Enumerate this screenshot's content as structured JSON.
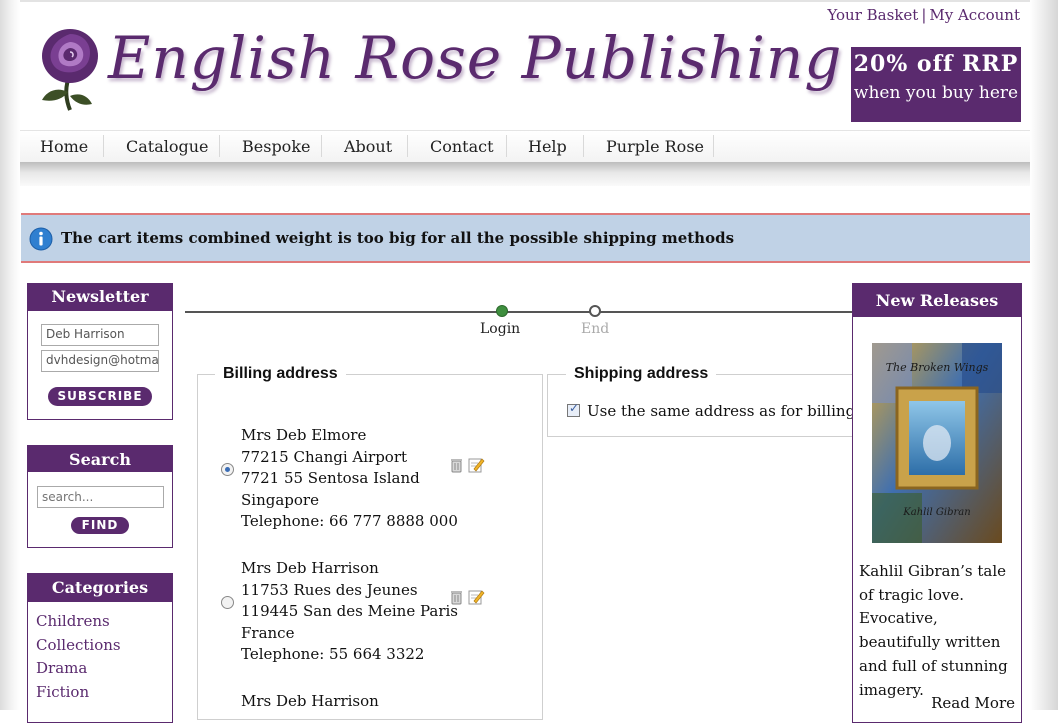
{
  "header": {
    "basket_link": "Your Basket",
    "separator": "|",
    "account_link": "My Account",
    "logo_text": "English Rose Publishing",
    "promo_line1": "20% off RRP",
    "promo_line2": "when you buy here"
  },
  "nav": {
    "items": [
      "Home",
      "Catalogue",
      "Bespoke",
      "About",
      "Contact",
      "Help",
      "Purple Rose"
    ]
  },
  "notice": {
    "icon": "info-icon",
    "message": "The cart items combined weight is too big for all the possible shipping methods"
  },
  "newsletter": {
    "title": "Newsletter",
    "name_value": "Deb Harrison",
    "email_value": "dvhdesign@hotma",
    "button": "SUBSCRIBE"
  },
  "search": {
    "title": "Search",
    "placeholder": "search...",
    "button": "FIND"
  },
  "categories": {
    "title": "Categories",
    "items": [
      "Childrens",
      "Collections",
      "Drama",
      "Fiction"
    ]
  },
  "checkout_steps": {
    "steps": [
      {
        "label": "Login",
        "state": "current"
      },
      {
        "label": "End",
        "state": "pending"
      }
    ]
  },
  "billing": {
    "legend": "Billing address",
    "addresses": [
      {
        "selected": true,
        "lines": [
          "Mrs Deb Elmore",
          "77215 Changi Airport",
          "7721 55 Sentosa Island",
          "Singapore",
          "Telephone: 66 777 8888 000"
        ]
      },
      {
        "selected": false,
        "lines": [
          "Mrs Deb Harrison",
          "11753 Rues des Jeunes",
          "119445 San des Meine Paris",
          "France",
          "Telephone: 55 664 3322"
        ]
      },
      {
        "selected": false,
        "lines": [
          "Mrs Deb Harrison"
        ]
      }
    ]
  },
  "shipping": {
    "legend": "Shipping address",
    "same_as_billing_checked": true,
    "same_as_billing_label": "Use the same address as for billing"
  },
  "new_releases": {
    "title": "New Releases",
    "book_cover_title": "The Broken Wings",
    "book_cover_author": "Kahlil Gibran",
    "description": "Kahlil Gibran’s tale of tragic love. Evocative, beautifully written and full of stunning imagery.",
    "read_more": "Read More"
  },
  "colors": {
    "brand_purple": "#5a2a6e",
    "notice_bg": "#c0d2e6",
    "notice_border": "#e07a7a"
  }
}
